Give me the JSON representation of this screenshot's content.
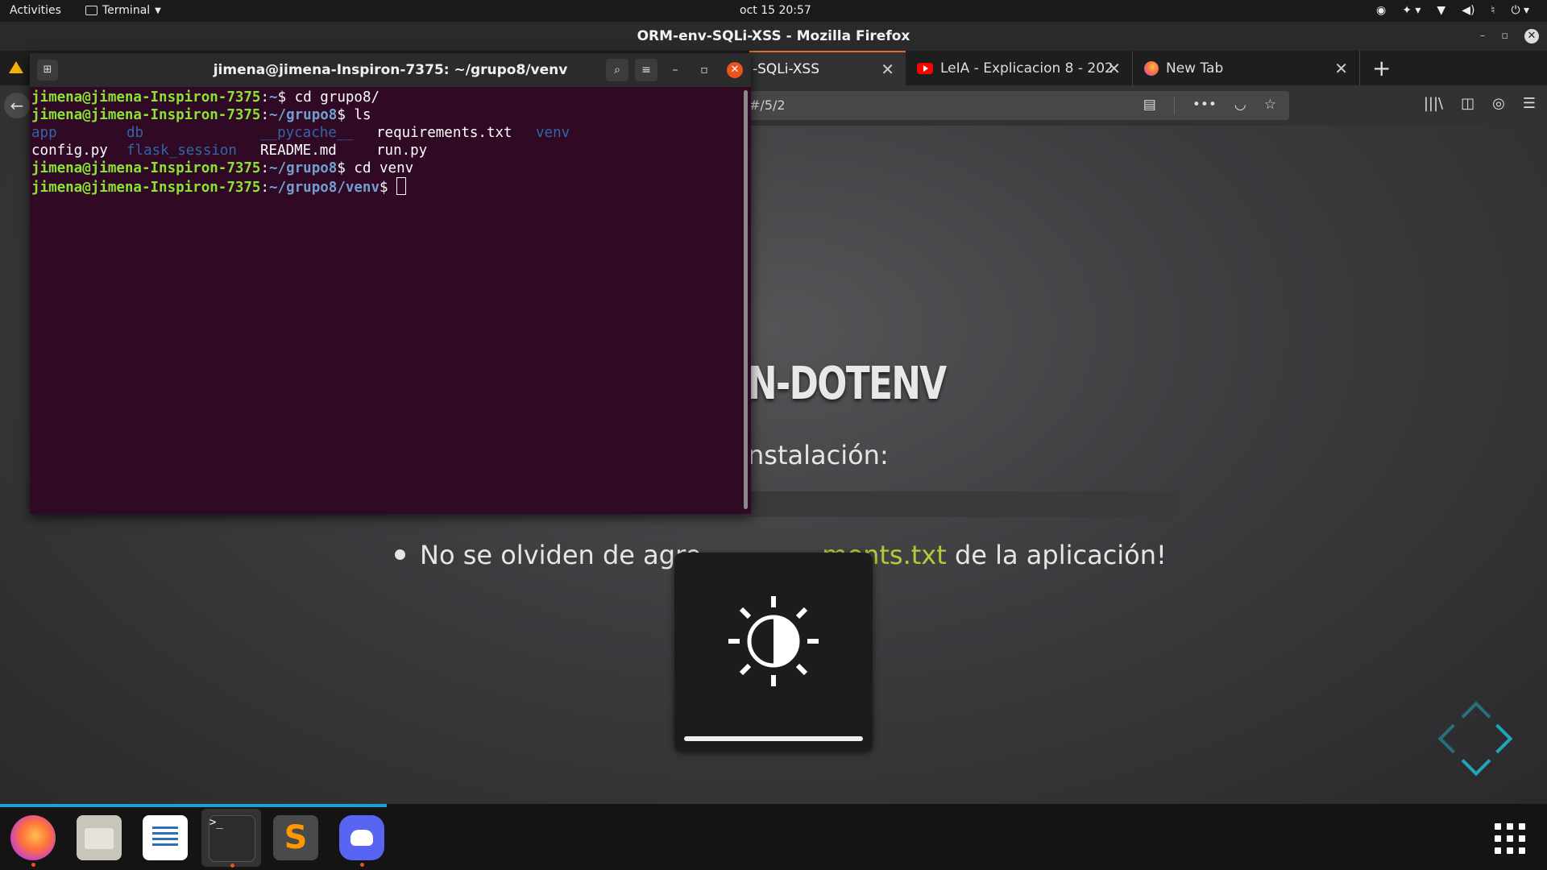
{
  "topbar": {
    "activities": "Activities",
    "app_name": "Terminal",
    "clock": "oct 15  20:57",
    "tray_icons": [
      "discord-tray-icon",
      "accessibility-icon",
      "wifi-icon",
      "volume-icon",
      "microphone-icon",
      "power-icon"
    ]
  },
  "firefox": {
    "window_title": "ORM-env-SQLi-XSS - Mozilla Firefox",
    "tabs": [
      {
        "label": "-SQLi-XSS",
        "active": true
      },
      {
        "label": "LeIA - Explicacion 8 - 202",
        "active": false
      },
      {
        "label": "New Tab",
        "active": false
      }
    ],
    "url_fragment": "#/5/2"
  },
  "slide": {
    "heading": "N-DOTENV",
    "subheading": "nstalación:",
    "bullet_before": "No se olviden de agre",
    "bullet_highlight": "ments.txt",
    "bullet_after": " de la aplicación!",
    "highlight_color": "#b7c93a",
    "nav_color": "#1fa6b8"
  },
  "osd": {
    "icon": "brightness-icon",
    "level": 1.0
  },
  "terminal": {
    "title": "jimena@jimena-Inspiron-7375: ~/grupo8/venv",
    "prompt_user": "jimena@jimena-Inspiron-7375",
    "lines": {
      "l1_path": "~",
      "l1_cmd": "cd grupo8/",
      "l2_path": "~/grupo8",
      "l2_cmd": "ls",
      "ls_row1": [
        "app",
        "db",
        "__pycache__",
        "requirements.txt",
        "venv"
      ],
      "ls_row2": [
        "config.py",
        "flask_session",
        "README.md",
        "run.py"
      ],
      "l3_path": "~/grupo8",
      "l3_cmd": "cd venv",
      "l4_path": "~/grupo8/venv"
    },
    "colors": {
      "background": "#300a24",
      "user": "#8ae234",
      "path": "#729fcf",
      "dir": "#3465a4"
    }
  },
  "dock": {
    "apps": [
      "Firefox",
      "Files",
      "LibreOffice Writer",
      "Terminal",
      "Sublime Text",
      "Discord"
    ],
    "show_apps": "show-applications-icon",
    "accent": "#e95420"
  }
}
